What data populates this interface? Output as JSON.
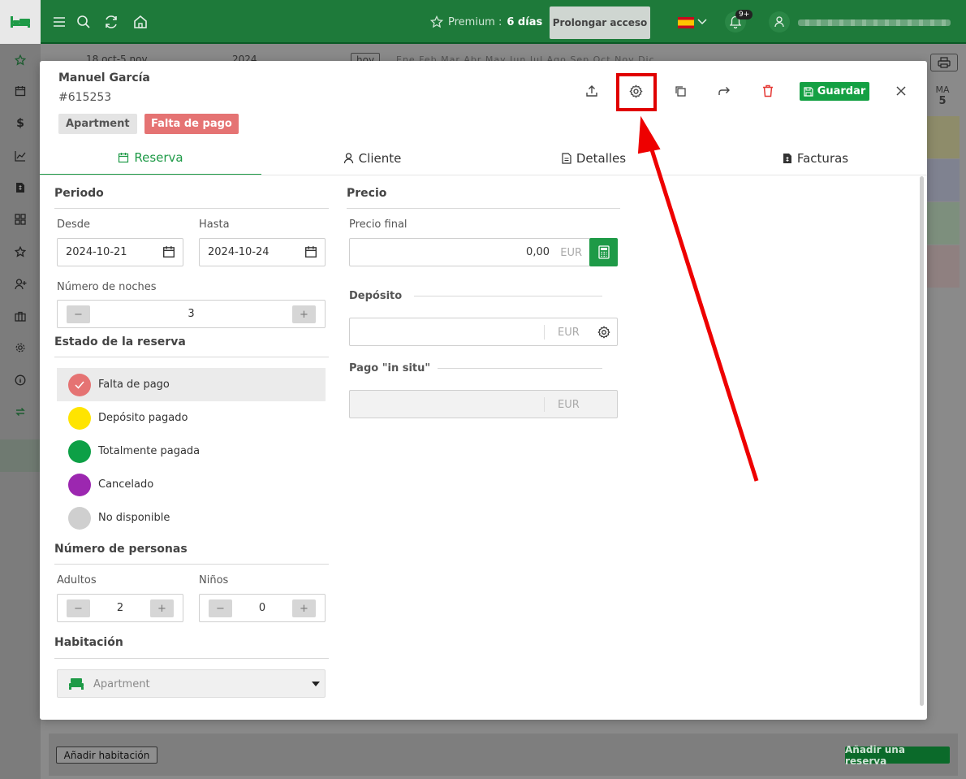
{
  "topbar": {
    "premium_label": "Premium :",
    "premium_days": "6 días",
    "prolong_button": "Prolongar acceso",
    "notifications_badge": "9+",
    "brand_color": "#1e7a3a"
  },
  "background": {
    "date_range": "18 oct-5 nov",
    "year": "2024",
    "today_button": "hoy",
    "months": "Ene Feb Mar Abr May Jun Jul Ago Sep Oct Nov Dic",
    "column_day": "MA",
    "column_num": "5",
    "add_room_button": "Añadir habitación",
    "add_reservation_button": "Añadir una reserva"
  },
  "modal": {
    "guest_name": "Manuel García",
    "reservation_id": "#615253",
    "tags": {
      "room_type": "Apartment",
      "payment_status": "Falta de pago"
    },
    "save_button": "Guardar",
    "tabs": [
      {
        "label": "Reserva",
        "icon": "calendar-icon",
        "active": true
      },
      {
        "label": "Cliente",
        "icon": "user-icon",
        "active": false
      },
      {
        "label": "Detalles",
        "icon": "document-icon",
        "active": false
      },
      {
        "label": "Facturas",
        "icon": "invoice-icon",
        "active": false
      }
    ],
    "periodo": {
      "title": "Periodo",
      "from_label": "Desde",
      "from_value": "2024-10-21",
      "to_label": "Hasta",
      "to_value": "2024-10-24",
      "nights_label": "Número de noches",
      "nights_value": "3"
    },
    "estado": {
      "title": "Estado de la reserva",
      "options": [
        {
          "label": "Falta de pago",
          "color": "#e57373",
          "selected": true
        },
        {
          "label": "Depósito pagado",
          "color": "#ffe400",
          "selected": false
        },
        {
          "label": "Totalmente pagada",
          "color": "#0da046",
          "selected": false
        },
        {
          "label": "Cancelado",
          "color": "#9c27b0",
          "selected": false
        },
        {
          "label": "No disponible",
          "color": "#cfcfcf",
          "selected": false
        }
      ]
    },
    "personas": {
      "title": "Número de personas",
      "adults_label": "Adultos",
      "adults_value": "2",
      "children_label": "Niños",
      "children_value": "0"
    },
    "habitacion": {
      "title": "Habitación",
      "selected": "Apartment"
    },
    "precio": {
      "title": "Precio",
      "final_label": "Precio final",
      "final_value": "0,00",
      "currency": "EUR",
      "deposit_label": "Depósito",
      "deposit_currency": "EUR",
      "onsite_label": "Pago \"in situ\"",
      "onsite_currency": "EUR"
    }
  },
  "annotation": {
    "highlight_color": "#e00000"
  }
}
